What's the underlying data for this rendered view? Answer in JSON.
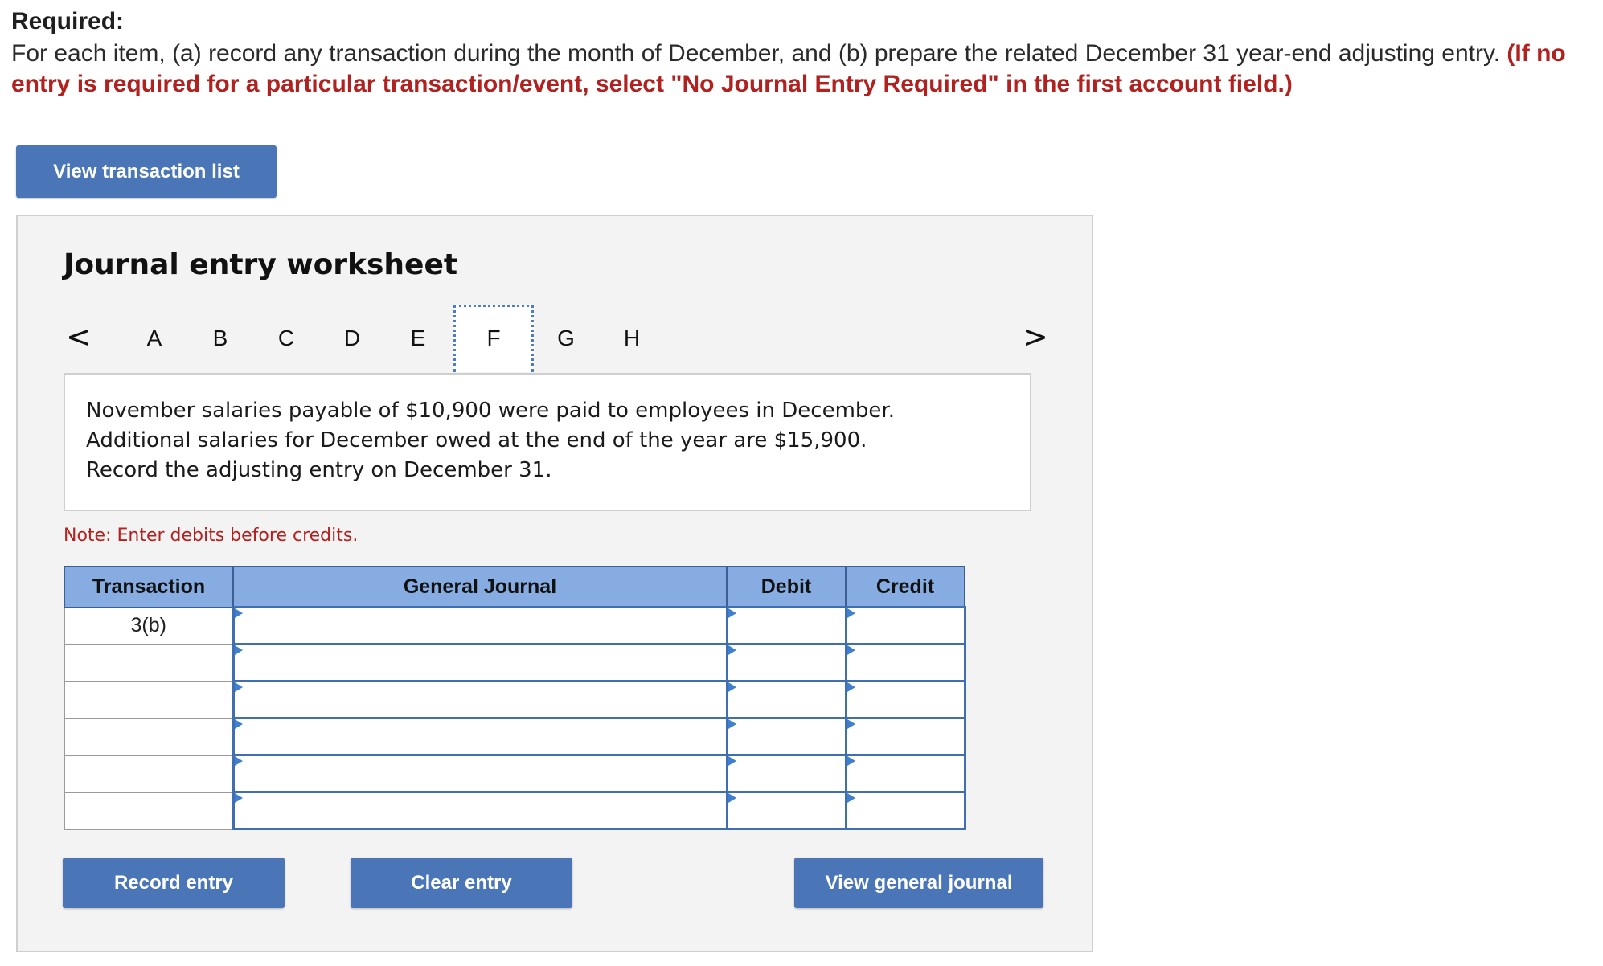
{
  "header": {
    "required_label": "Required:",
    "instructions_text": "For each item, (a) record any transaction during the month of December, and (b) prepare the related December 31 year-end adjusting entry. ",
    "instructions_note": "(If no entry is required for a particular transaction/event, select \"No Journal Entry Required\" in the first account field.)"
  },
  "buttons": {
    "view_transaction_list": "View transaction list",
    "record_entry": "Record entry",
    "clear_entry": "Clear entry",
    "view_general_journal": "View general journal"
  },
  "worksheet": {
    "title": "Journal entry worksheet",
    "nav": {
      "prev": "<",
      "next": ">",
      "letters": [
        "A",
        "B",
        "C",
        "D",
        "E",
        "F",
        "G",
        "H"
      ],
      "active": "F"
    },
    "prompt_lines": [
      "November salaries payable of $10,900 were paid to employees in December.",
      "Additional salaries for December owed at the end of the year are $15,900.",
      "Record the adjusting entry on December 31."
    ],
    "note": "Note: Enter debits before credits."
  },
  "table": {
    "headers": {
      "transaction": "Transaction",
      "general_journal": "General Journal",
      "debit": "Debit",
      "credit": "Credit"
    },
    "rows": [
      {
        "transaction": "3(b)",
        "account": "",
        "debit": "",
        "credit": ""
      },
      {
        "transaction": "",
        "account": "",
        "debit": "",
        "credit": ""
      },
      {
        "transaction": "",
        "account": "",
        "debit": "",
        "credit": ""
      },
      {
        "transaction": "",
        "account": "",
        "debit": "",
        "credit": ""
      },
      {
        "transaction": "",
        "account": "",
        "debit": "",
        "credit": ""
      },
      {
        "transaction": "",
        "account": "",
        "debit": "",
        "credit": ""
      }
    ]
  },
  "colors": {
    "button": "#4a76b8",
    "header_fill": "#86ace2",
    "note_red": "#b0211f"
  }
}
